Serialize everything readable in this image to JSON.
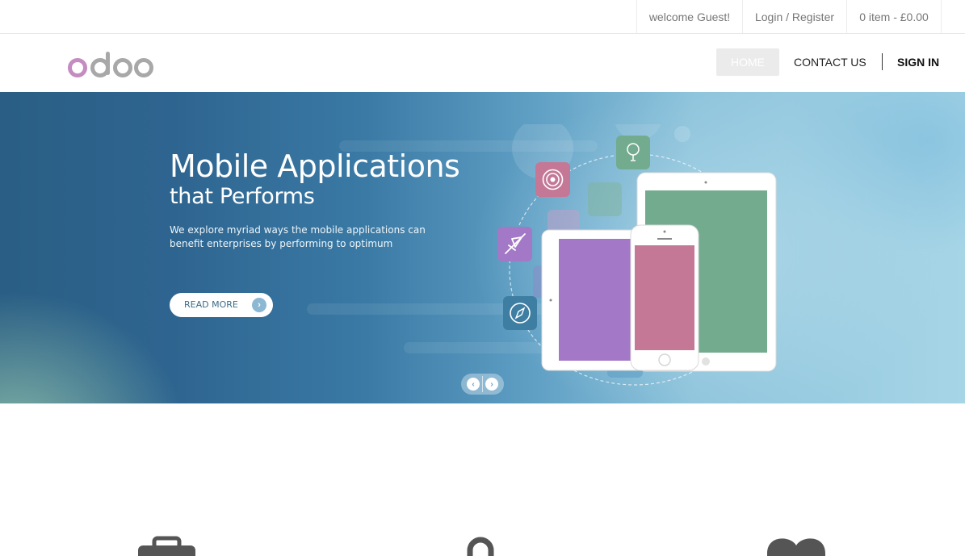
{
  "topbar": {
    "welcome": "welcome Guest!",
    "login_register": "Login / Register",
    "cart": "0 item - £0.00"
  },
  "header": {
    "logo_text": "odoo",
    "nav": {
      "home": "HOME",
      "contact": "CONTACT US",
      "signin": "SIGN IN"
    }
  },
  "hero": {
    "title": "Mobile Applications",
    "subtitle": "that Performs",
    "description": "We explore myriad ways the mobile applications can benefit enterprises by performing to optimum",
    "cta": "READ MORE",
    "app_icons": [
      "target-icon",
      "lightbulb-icon",
      "airplane-icon",
      "compass-icon"
    ],
    "devices": [
      "tablet-large",
      "tablet-small",
      "phone"
    ]
  },
  "features": {
    "icons": [
      "briefcase-icon",
      "lock-icon",
      "heart-icon"
    ]
  },
  "colors": {
    "logo_purple": "#c48cc0",
    "logo_gray": "#a8a8a8",
    "home_bg": "#ebebeb",
    "hero_dark": "#2a5e84",
    "hero_light": "#a6d5e6",
    "device_green": "#72ab8e",
    "device_purple": "#a378c6",
    "device_pink": "#c47896",
    "feature_icon": "#555555"
  }
}
